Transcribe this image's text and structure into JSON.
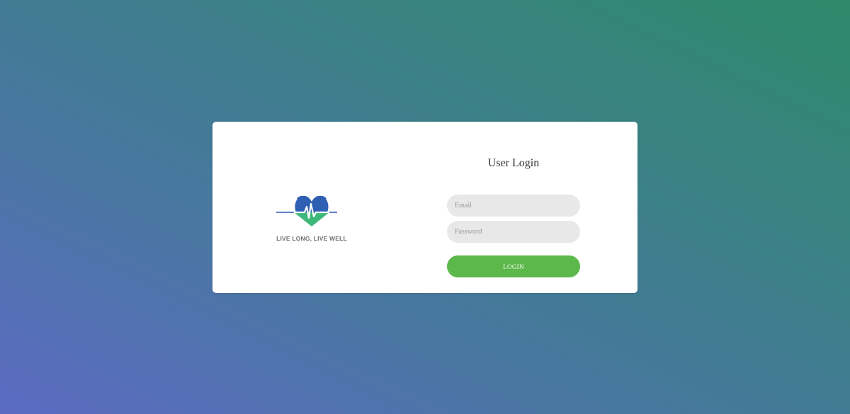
{
  "brand": {
    "logo_icon": "heart-pulse-icon",
    "tagline": "LIVE LONG, LIVE WELL",
    "colors": {
      "heart": "#2f5fb3",
      "heart_bottom": "#3db87a",
      "pulse": "#ffffff"
    }
  },
  "login": {
    "title": "User Login",
    "email_placeholder": "Email",
    "email_value": "",
    "password_placeholder": "Password",
    "password_value": "",
    "button_label": "LOGIN"
  },
  "theme": {
    "gradient_start": "#5b6bc2",
    "gradient_end": "#2e8a6a",
    "button_color": "#5cb84a",
    "input_bg": "#e8e8e8"
  }
}
